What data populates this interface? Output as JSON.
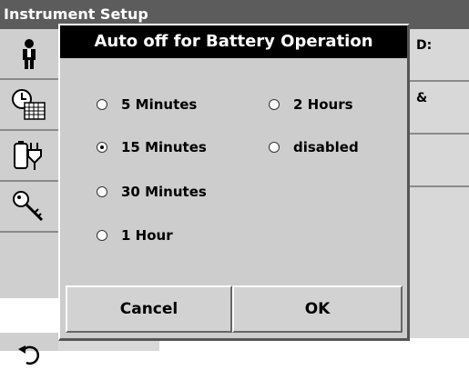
{
  "window": {
    "title": "Instrument Setup"
  },
  "sidebar": {
    "items": [
      {
        "icon": "person-icon"
      },
      {
        "icon": "clock-calendar-icon"
      },
      {
        "icon": "battery-plug-icon"
      },
      {
        "icon": "key-icon"
      }
    ],
    "back_icon": "back-arrow-icon"
  },
  "background": {
    "row1_text": "D:",
    "row2_text": "&"
  },
  "dialog": {
    "title": "Auto off for Battery Operation",
    "options": [
      {
        "label": "5 Minutes",
        "selected": false
      },
      {
        "label": "15 Minutes",
        "selected": true
      },
      {
        "label": "30 Minutes",
        "selected": false
      },
      {
        "label": "1 Hour",
        "selected": false
      },
      {
        "label": "2 Hours",
        "selected": false
      },
      {
        "label": "disabled",
        "selected": false
      }
    ],
    "cancel_label": "Cancel",
    "ok_label": "OK"
  }
}
